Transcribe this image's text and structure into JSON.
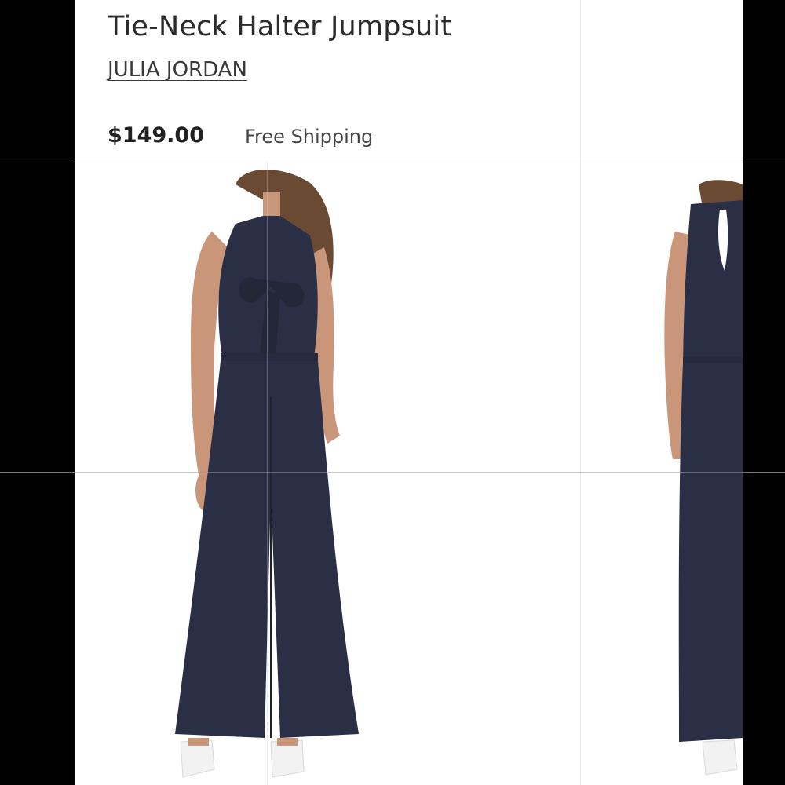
{
  "product": {
    "title": "Tie-Neck Halter Jumpsuit",
    "brand": "JULIA JORDAN",
    "price": "$149.00",
    "shipping": "Free Shipping"
  },
  "gallery": {
    "images": [
      {
        "name": "front-view"
      },
      {
        "name": "back-view"
      }
    ]
  },
  "colors": {
    "jumpsuit": "#2a2f45",
    "skin": "#c9967a",
    "hair": "#6b4a33",
    "shoes": "#f2f2f2"
  }
}
